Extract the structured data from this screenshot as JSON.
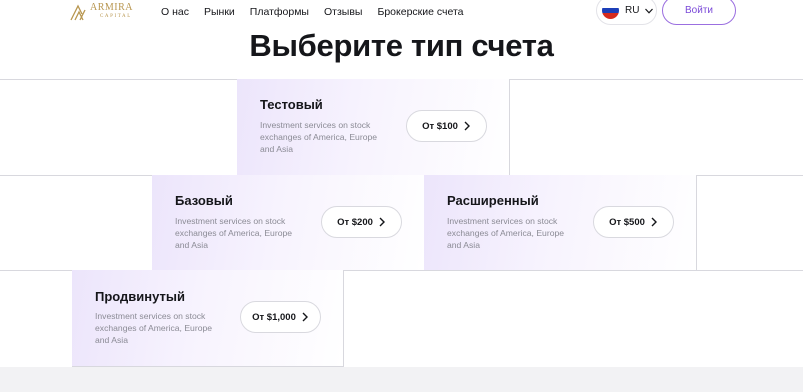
{
  "header": {
    "logo": {
      "name": "ARMIRA",
      "sub": "CAPITAL"
    },
    "nav": [
      "О нас",
      "Рынки",
      "Платформы",
      "Отзывы",
      "Брокерские счета"
    ],
    "language": {
      "code": "RU",
      "flag_icon": "russia-flag-icon"
    },
    "login_label": "Войти"
  },
  "page": {
    "title": "Выберите тип счета"
  },
  "cards": [
    {
      "title": "Тестовый",
      "description": "Investment services on stock exchanges of America, Europe and Asia",
      "price_label": "От $100"
    },
    {
      "title": "Базовый",
      "description": "Investment services on stock exchanges of America, Europe and Asia",
      "price_label": "От $200"
    },
    {
      "title": "Расширенный",
      "description": "Investment services on stock exchanges of America, Europe and Asia",
      "price_label": "От $500"
    },
    {
      "title": "Продвинутый",
      "description": "Investment services on stock exchanges of America, Europe and Asia",
      "price_label": "От $1,000"
    }
  ],
  "colors": {
    "accent": "#7a49d8",
    "logo_gold": "#b8964f",
    "card_tint": "#ece5fb"
  }
}
